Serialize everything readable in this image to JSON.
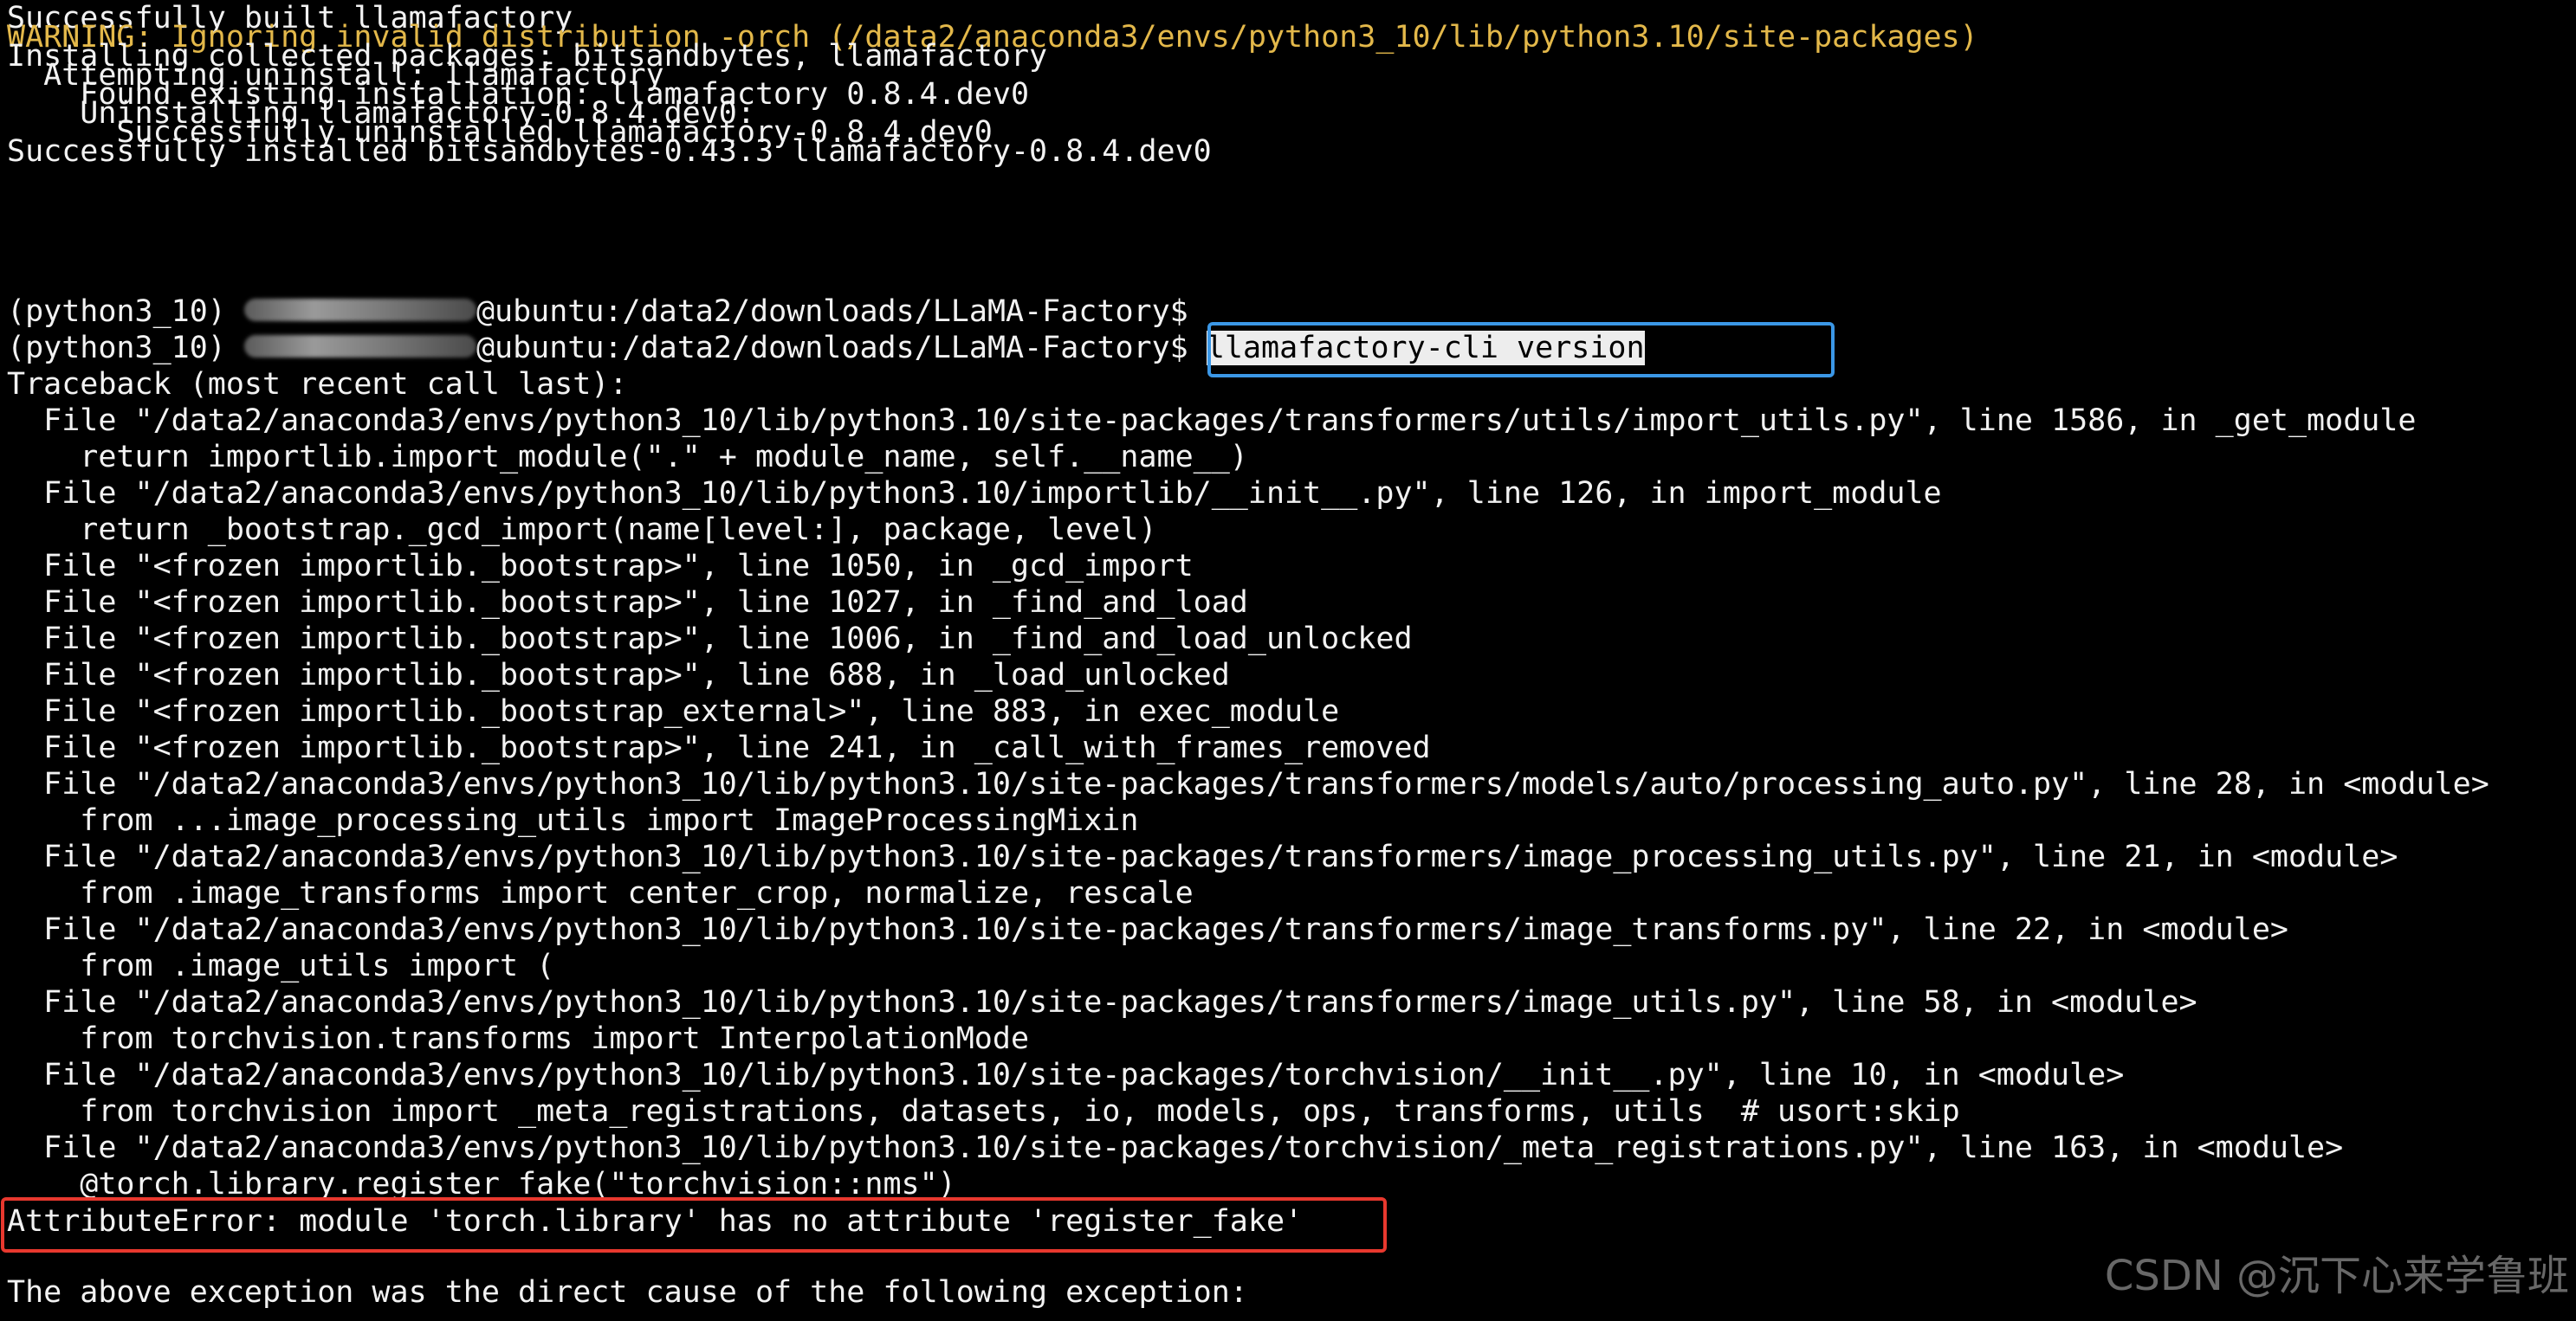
{
  "terminal": {
    "lines": [
      "Successfully built llamafactory",
      "WARNING: Ignoring invalid distribution -orch (/data2/anaconda3/envs/python3_10/lib/python3.10/site-packages)",
      "Installing collected packages: bitsandbytes, llamafactory",
      "  Attempting uninstall: llamafactory",
      "    Found existing installation: llamafactory 0.8.4.dev0",
      "    Uninstalling llamafactory-0.8.4.dev0:",
      "      Successfully uninstalled llamafactory-0.8.4.dev0",
      "Successfully installed bitsandbytes-0.43.3 llamafactory-0.8.4.dev0"
    ],
    "prompt_env": "(python3_10) ",
    "prompt_host_path": "@ubuntu:/data2/downloads/LLaMA-Factory$",
    "command": "llamafactory-cli version",
    "traceback": [
      "Traceback (most recent call last):",
      "  File \"/data2/anaconda3/envs/python3_10/lib/python3.10/site-packages/transformers/utils/import_utils.py\", line 1586, in _get_module",
      "    return importlib.import_module(\".\" + module_name, self.__name__)",
      "  File \"/data2/anaconda3/envs/python3_10/lib/python3.10/importlib/__init__.py\", line 126, in import_module",
      "    return _bootstrap._gcd_import(name[level:], package, level)",
      "  File \"<frozen importlib._bootstrap>\", line 1050, in _gcd_import",
      "  File \"<frozen importlib._bootstrap>\", line 1027, in _find_and_load",
      "  File \"<frozen importlib._bootstrap>\", line 1006, in _find_and_load_unlocked",
      "  File \"<frozen importlib._bootstrap>\", line 688, in _load_unlocked",
      "  File \"<frozen importlib._bootstrap_external>\", line 883, in exec_module",
      "  File \"<frozen importlib._bootstrap>\", line 241, in _call_with_frames_removed",
      "  File \"/data2/anaconda3/envs/python3_10/lib/python3.10/site-packages/transformers/models/auto/processing_auto.py\", line 28, in <module>",
      "    from ...image_processing_utils import ImageProcessingMixin",
      "  File \"/data2/anaconda3/envs/python3_10/lib/python3.10/site-packages/transformers/image_processing_utils.py\", line 21, in <module>",
      "    from .image_transforms import center_crop, normalize, rescale",
      "  File \"/data2/anaconda3/envs/python3_10/lib/python3.10/site-packages/transformers/image_transforms.py\", line 22, in <module>",
      "    from .image_utils import (",
      "  File \"/data2/anaconda3/envs/python3_10/lib/python3.10/site-packages/transformers/image_utils.py\", line 58, in <module>",
      "    from torchvision.transforms import InterpolationMode",
      "  File \"/data2/anaconda3/envs/python3_10/lib/python3.10/site-packages/torchvision/__init__.py\", line 10, in <module>",
      "    from torchvision import _meta_registrations, datasets, io, models, ops, transforms, utils  # usort:skip",
      "  File \"/data2/anaconda3/envs/python3_10/lib/python3.10/site-packages/torchvision/_meta_registrations.py\", line 163, in <module>",
      "    @torch.library.register_fake(\"torchvision::nms\")"
    ],
    "error": "AttributeError: module 'torch.library' has no attribute 'register_fake'",
    "footer": "The above exception was the direct cause of the following exception:"
  },
  "watermark": "CSDN @沉下心来学鲁班",
  "colors": {
    "background": "#000000",
    "text": "#f2f2f2",
    "warning": "#e3b84a",
    "highlight_box": "#3b97e6",
    "error_box": "#e8382e"
  }
}
